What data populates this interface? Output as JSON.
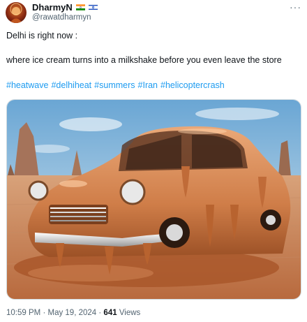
{
  "author": {
    "display_name": "DharmyN",
    "handle": "@rawatdharmyn"
  },
  "menu_icon": "more-horizontal-icon",
  "tweet": {
    "line1": "Delhi is right now :",
    "line2": "where ice cream turns into a milkshake before you even leave the store",
    "hashtags": [
      "#heatwave",
      "#delhiheat",
      "#summers",
      "#Iran",
      "#helicoptercrash"
    ]
  },
  "media": {
    "subject": "Vintage car made of melting caramel ice cream in a desert"
  },
  "meta": {
    "time": "10:59 PM",
    "separator": "·",
    "date": "May 19, 2024",
    "views_count": "641",
    "views_label": "Views"
  },
  "colors": {
    "link": "#1d9bf0",
    "secondary_text": "#536471",
    "primary_text": "#0f1419"
  }
}
